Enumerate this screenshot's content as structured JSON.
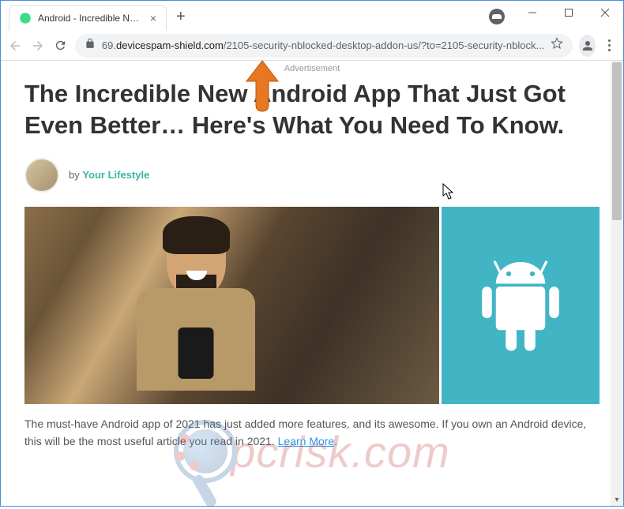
{
  "tab": {
    "title": "Android - Incredible New App - E",
    "close": "×"
  },
  "url": {
    "prefix": "69.",
    "domain": "devicespam-shield.com",
    "path": "/2105-security-nblocked-desktop-addon-us/?to=2105-security-nblock..."
  },
  "page": {
    "ad_label": "Advertisement",
    "headline": "The Incredible New Android App That Just Got Even Better… Here's What You Need To Know.",
    "by": "by ",
    "author": "Your Lifestyle",
    "body_prefix": "The must-have Android app of 2021 has just added more features, and its awesome. If you own an Android device, this will be the most useful article you read in 2021. ",
    "learn_more": "Learn More",
    "period": "."
  },
  "watermark": "pcrisk.com"
}
